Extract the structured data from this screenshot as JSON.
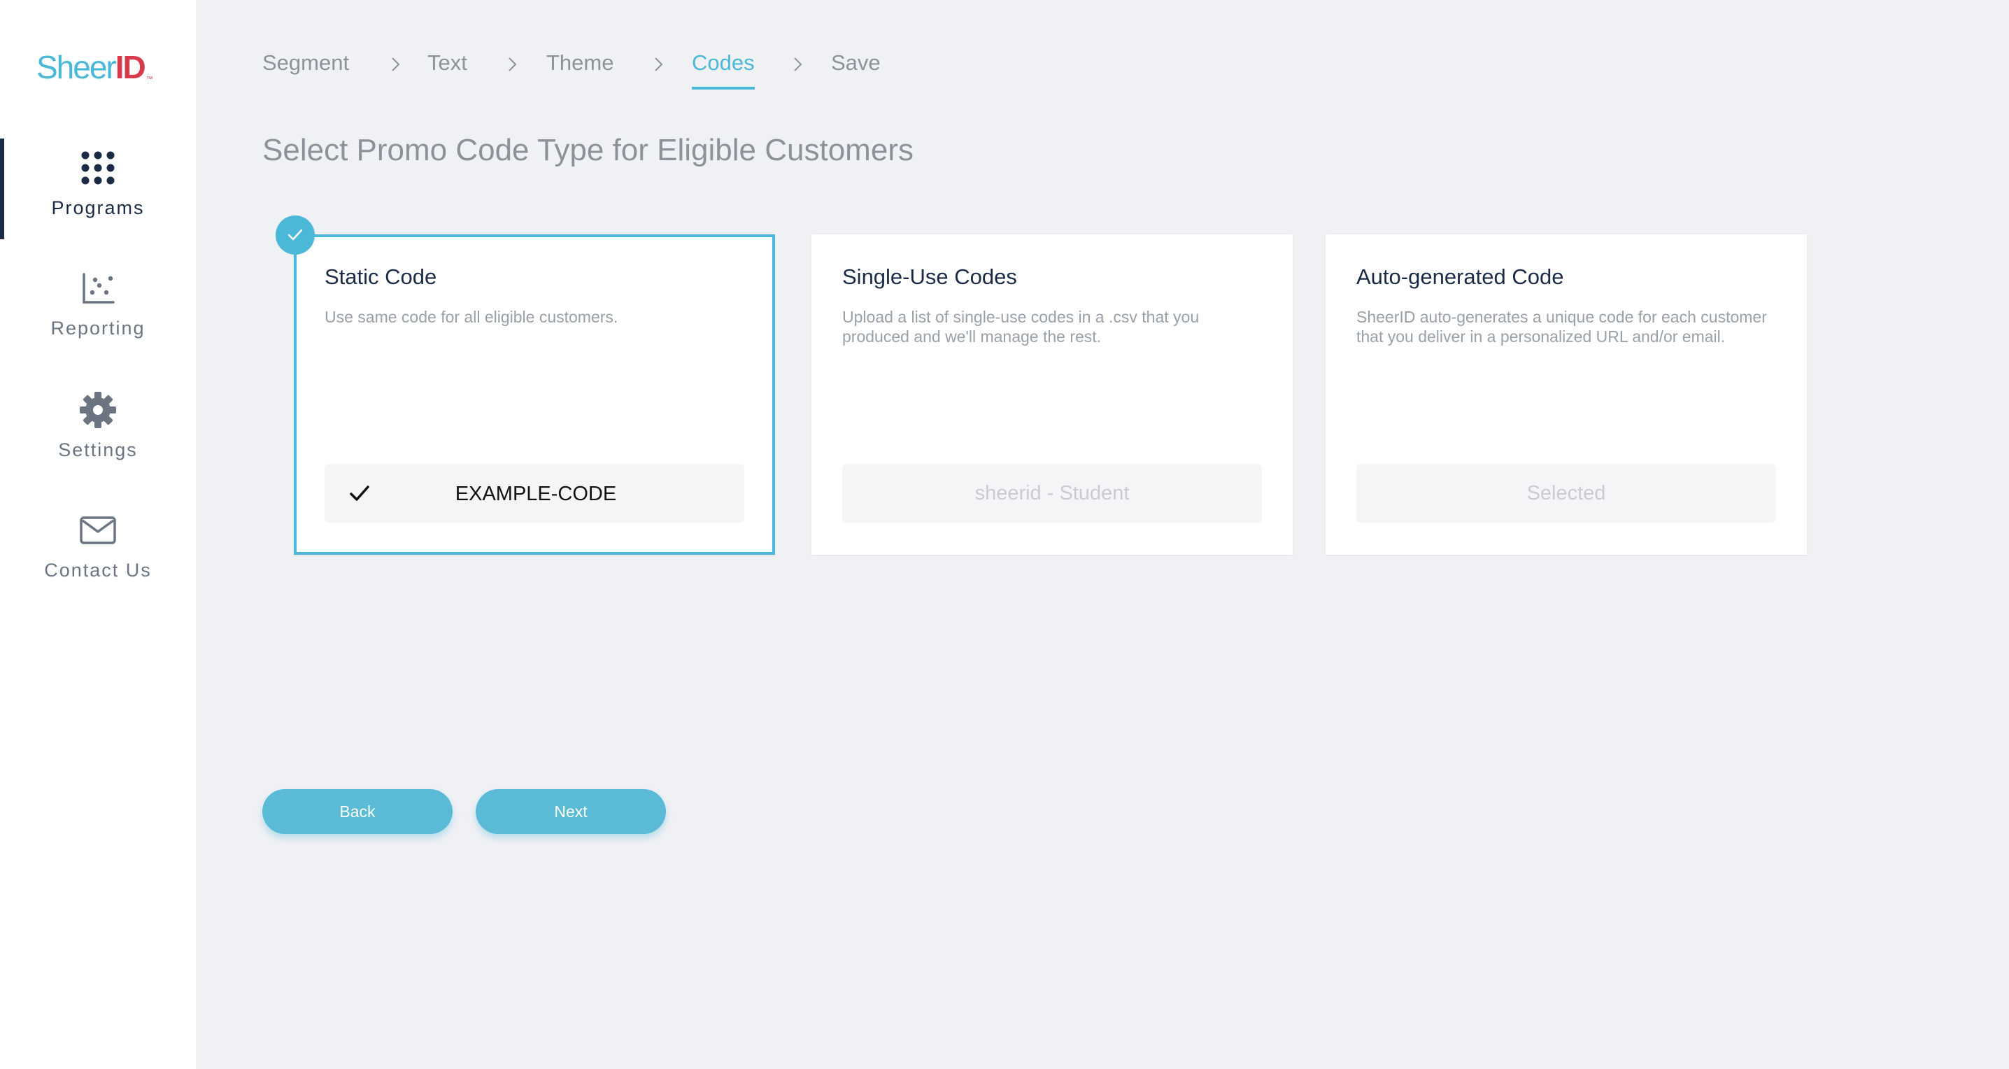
{
  "brand": {
    "logo_left": "Sheer",
    "logo_right": "ID",
    "logo_tm": "™",
    "accent": "#4ab8d6",
    "logo_red": "#d73a4a"
  },
  "sidebar": {
    "items": [
      {
        "label": "Programs",
        "icon": "grid-dots-icon",
        "active": true
      },
      {
        "label": "Reporting",
        "icon": "scatter-chart-icon",
        "active": false
      },
      {
        "label": "Settings",
        "icon": "gear-icon",
        "active": false
      },
      {
        "label": "Contact Us",
        "icon": "envelope-icon",
        "active": false
      }
    ]
  },
  "breadcrumb": {
    "steps": [
      {
        "label": "Segment"
      },
      {
        "label": "Text"
      },
      {
        "label": "Theme"
      },
      {
        "label": "Codes",
        "active": true
      },
      {
        "label": "Save"
      }
    ]
  },
  "page": {
    "title": "Select Promo Code Type for Eligible Customers"
  },
  "cards": [
    {
      "title": "Static Code",
      "description": "Use same code for all eligible customers.",
      "field_value": "EXAMPLE-CODE",
      "selected": true
    },
    {
      "title": "Single-Use Codes",
      "description": "Upload a list of single-use codes in a .csv that you produced and we'll manage the rest.",
      "field_value": "sheerid - Student",
      "selected": false
    },
    {
      "title": "Auto-generated Code",
      "description": "SheerID auto-generates a unique code for each customer that you deliver in a personalized URL and/or email.",
      "field_value": "Selected",
      "selected": false
    }
  ],
  "actions": {
    "back_label": "Back",
    "next_label": "Next"
  }
}
